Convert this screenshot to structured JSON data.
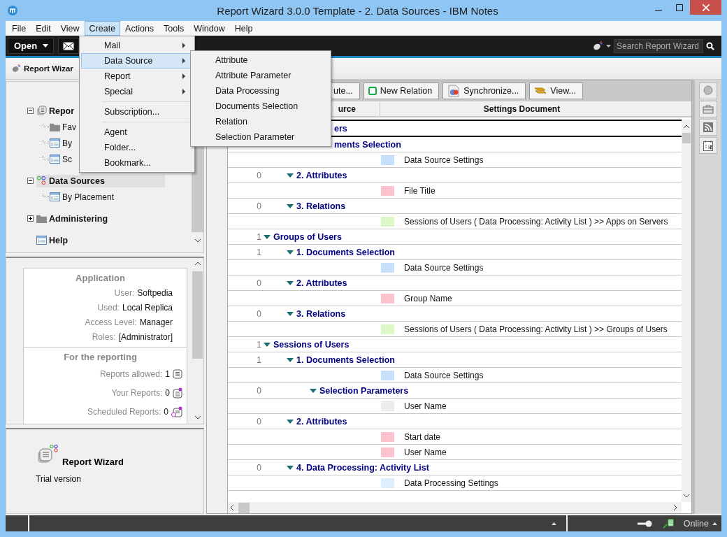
{
  "window": {
    "title": "Report Wizard 3.0.0 Template - 2. Data Sources - IBM Notes"
  },
  "menu_bar": [
    {
      "label": "File",
      "selected": false
    },
    {
      "label": "Edit",
      "selected": false
    },
    {
      "label": "View",
      "selected": false
    },
    {
      "label": "Create",
      "selected": true
    },
    {
      "label": "Actions",
      "selected": false
    },
    {
      "label": "Tools",
      "selected": false
    },
    {
      "label": "Window",
      "selected": false
    },
    {
      "label": "Help",
      "selected": false
    }
  ],
  "create_menu": {
    "groups": [
      [
        {
          "label": "Mail",
          "submenu": true,
          "selected": false
        },
        {
          "label": "Data Source",
          "submenu": true,
          "selected": true
        },
        {
          "label": "Report",
          "submenu": true,
          "selected": false
        },
        {
          "label": "Special",
          "submenu": true,
          "selected": false
        }
      ],
      [
        {
          "label": "Subscription...",
          "submenu": false,
          "selected": false
        }
      ],
      [
        {
          "label": "Agent",
          "submenu": false,
          "selected": false
        },
        {
          "label": "Folder...",
          "submenu": false,
          "selected": false
        },
        {
          "label": "Bookmark...",
          "submenu": false,
          "selected": false
        }
      ]
    ]
  },
  "data_source_submenu": [
    "Attribute",
    "Attribute Parameter",
    "Data Processing",
    "Documents Selection",
    "Relation",
    "Selection Parameter"
  ],
  "toolbar": {
    "open_button": "Open",
    "search": {
      "placeholder": "Search Report Wizard"
    }
  },
  "tabs": [
    {
      "label": "Report Wizar",
      "selected": true
    }
  ],
  "navigator": {
    "items": [
      {
        "label": "Repor",
        "kind": "reports",
        "expanded": true,
        "selected": false,
        "children": [
          {
            "label": "Fav",
            "kind": "folder",
            "selected": false
          },
          {
            "label": "By",
            "kind": "view",
            "selected": false
          },
          {
            "label": "Sc",
            "kind": "view",
            "selected": false
          }
        ]
      },
      {
        "label": "Data Sources",
        "kind": "sources",
        "expanded": true,
        "selected": true,
        "children": [
          {
            "label": "By Placement",
            "kind": "view",
            "selected": false
          }
        ]
      },
      {
        "label": "Administering",
        "kind": "folder",
        "expanded": false,
        "selected": false
      },
      {
        "label": "Help",
        "kind": "view",
        "selected": false
      }
    ]
  },
  "info": {
    "sections": [
      {
        "heading": "Application",
        "rows": [
          {
            "label": "User:",
            "value": "Softpedia"
          },
          {
            "label": "Used:",
            "value": "Local Replica"
          },
          {
            "label": "Access Level:",
            "value": "Manager"
          },
          {
            "label": "Roles:",
            "value": "[Administrator]"
          }
        ]
      },
      {
        "heading": "For the reporting",
        "rows": [
          {
            "label": "Reports allowed:",
            "value": "1",
            "kind": "allowed"
          },
          {
            "label": "Your Reports:",
            "value": "0",
            "kind": "own"
          },
          {
            "label": "Scheduled Reports:",
            "value": "0",
            "kind": "scheduled"
          }
        ]
      }
    ]
  },
  "about": {
    "title": "Report Wizard",
    "subtitle": "Trial version"
  },
  "view_actions": [
    {
      "label": "ute...",
      "kind": "plain"
    },
    {
      "label": "New Relation",
      "kind": "relation"
    },
    {
      "label": "Synchronize...",
      "kind": "sync"
    },
    {
      "label": "View...",
      "kind": "view"
    }
  ],
  "columns": [
    "urce",
    "Settings Document"
  ],
  "rows": [
    {
      "label": "ers",
      "kind": "cut",
      "selected": true,
      "children": [
        {
          "label": "ments Selection",
          "kind": "cut",
          "selected": false,
          "children": [
            {
              "label": "Data Source Settings",
              "color": "#c6e0fb",
              "selected": false
            }
          ]
        },
        {
          "label": "2. Attributes",
          "count": "0",
          "selected": false,
          "children": [
            {
              "label": "File Title",
              "color": "#fbc3cd",
              "selected": false
            }
          ]
        },
        {
          "label": "3. Relations",
          "count": "0",
          "selected": false,
          "children": [
            {
              "label": "Sessions of Users ( Data Processing: Activity List ) >> Apps on Servers",
              "color": "#def7c6",
              "selected": false
            }
          ]
        }
      ]
    },
    {
      "label": "Groups of Users",
      "count": "1",
      "selected": false,
      "children": [
        {
          "label": "1. Documents Selection",
          "count": "1",
          "selected": false,
          "children": [
            {
              "label": "Data Source Settings",
              "color": "#c6e0fb",
              "selected": false
            }
          ]
        },
        {
          "label": "2. Attributes",
          "count": "0",
          "selected": false,
          "children": [
            {
              "label": "Group Name",
              "color": "#fbc3cd",
              "selected": false
            }
          ]
        },
        {
          "label": "3. Relations",
          "count": "0",
          "selected": false,
          "children": [
            {
              "label": "Sessions of Users ( Data Processing: Activity List ) >> Groups of Users",
              "color": "#def7c6",
              "selected": false
            }
          ]
        }
      ]
    },
    {
      "label": "Sessions of Users",
      "count": "1",
      "selected": false,
      "children": [
        {
          "label": "1. Documents Selection",
          "count": "1",
          "selected": false,
          "children": [
            {
              "label": "Data Source Settings",
              "color": "#c6e0fb",
              "selected": false
            },
            {
              "label": "Selection Parameters",
              "count": "0",
              "selected": false,
              "children": [
                {
                  "label": "User Name",
                  "color": "#ececec",
                  "selected": false
                }
              ]
            }
          ]
        },
        {
          "label": "2. Attributes",
          "count": "0",
          "selected": false,
          "children": [
            {
              "label": "Start date",
              "color": "#fbc3cd",
              "selected": false
            },
            {
              "label": "User Name",
              "color": "#fbc3cd",
              "selected": false
            }
          ]
        },
        {
          "label": "4. Data Processing: Activity List",
          "count": "0",
          "selected": false,
          "children": [
            {
              "label": "Data Processing Settings",
              "color": "#deeefc",
              "selected": false
            }
          ]
        }
      ]
    }
  ],
  "status_bar": {
    "connection": "Online"
  }
}
